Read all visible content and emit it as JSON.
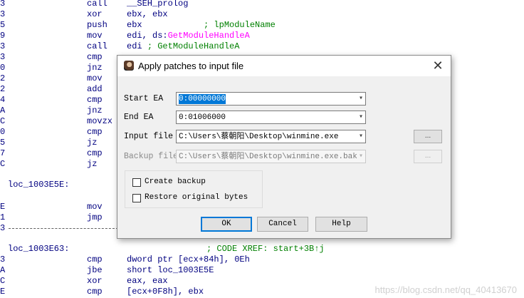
{
  "disasm": {
    "lines": [
      {
        "gutter": "3",
        "mnemonic": "call",
        "operand": "__SEH_prolog",
        "fn": "",
        "comment": ""
      },
      {
        "gutter": "3",
        "mnemonic": "xor",
        "operand": "ebx, ebx",
        "fn": "",
        "comment": ""
      },
      {
        "gutter": "5",
        "mnemonic": "push",
        "operand": "ebx",
        "fn": "",
        "comment": "            ; lpModuleName"
      },
      {
        "gutter": "9",
        "mnemonic": "mov",
        "operand": "edi, ds:",
        "fn": "GetModuleHandleA",
        "comment": ""
      },
      {
        "gutter": "3",
        "mnemonic": "call",
        "operand": "edi ",
        "fn": "",
        "comment": "; GetModuleHandleA"
      },
      {
        "gutter": "3",
        "mnemonic": "cmp",
        "operand": "",
        "fn": "",
        "comment": ""
      },
      {
        "gutter": "0",
        "mnemonic": "jnz",
        "operand": "",
        "fn": "",
        "comment": ""
      },
      {
        "gutter": "2",
        "mnemonic": "mov",
        "operand": "",
        "fn": "",
        "comment": ""
      },
      {
        "gutter": "2",
        "mnemonic": "add",
        "operand": "",
        "fn": "",
        "comment": ""
      },
      {
        "gutter": "4",
        "mnemonic": "cmp",
        "operand": "",
        "fn": "",
        "comment": ""
      },
      {
        "gutter": "A",
        "mnemonic": "jnz",
        "operand": "",
        "fn": "",
        "comment": ""
      },
      {
        "gutter": "C",
        "mnemonic": "movzx",
        "operand": "",
        "fn": "",
        "comment": ""
      },
      {
        "gutter": "0",
        "mnemonic": "cmp",
        "operand": "",
        "fn": "",
        "comment": ""
      },
      {
        "gutter": "5",
        "mnemonic": "jz",
        "operand": "",
        "fn": "",
        "comment": ""
      },
      {
        "gutter": "7",
        "mnemonic": "cmp",
        "operand": "",
        "fn": "",
        "comment": ""
      },
      {
        "gutter": "C",
        "mnemonic": "jz",
        "operand": "",
        "fn": "",
        "comment": ""
      }
    ],
    "label1": "loc_1003E5E:",
    "lines2": [
      {
        "gutter": "E",
        "mnemonic": "mov",
        "operand": ""
      },
      {
        "gutter": "1",
        "mnemonic": "jmp",
        "operand": ""
      }
    ],
    "sep_gutter": "3",
    "label2": "loc_1003E63:",
    "xref_comment": "; CODE XREF: start+3B↑j",
    "lines3": [
      {
        "gutter": "3",
        "mnemonic": "cmp",
        "operand": "dword ptr [ecx+84h], 0Eh"
      },
      {
        "gutter": "A",
        "mnemonic": "jbe",
        "operand": "short loc_1003E5E"
      },
      {
        "gutter": "C",
        "mnemonic": "xor",
        "operand": "eax, eax"
      },
      {
        "gutter": "E",
        "mnemonic": "cmp",
        "operand": "[ecx+0F8h], ebx"
      }
    ]
  },
  "watermark": "https://blog.csdn.net/qq_40413670",
  "dialog": {
    "title": "Apply patches to input file",
    "start_ea": {
      "label": "Start EA",
      "value": "0:00000000"
    },
    "end_ea": {
      "label": "End EA",
      "value": "0:01006000"
    },
    "input_file": {
      "label": "Input file",
      "value": "C:\\Users\\蔡朝阳\\Desktop\\winmine.exe",
      "browse": "..."
    },
    "backup_file": {
      "label": "Backup file",
      "value": "C:\\Users\\蔡朝阳\\Desktop\\winmine.exe.bak",
      "browse": "..."
    },
    "create_backup": "Create backup",
    "restore_original": "Restore original bytes",
    "ok": "OK",
    "cancel": "Cancel",
    "help": "Help"
  }
}
